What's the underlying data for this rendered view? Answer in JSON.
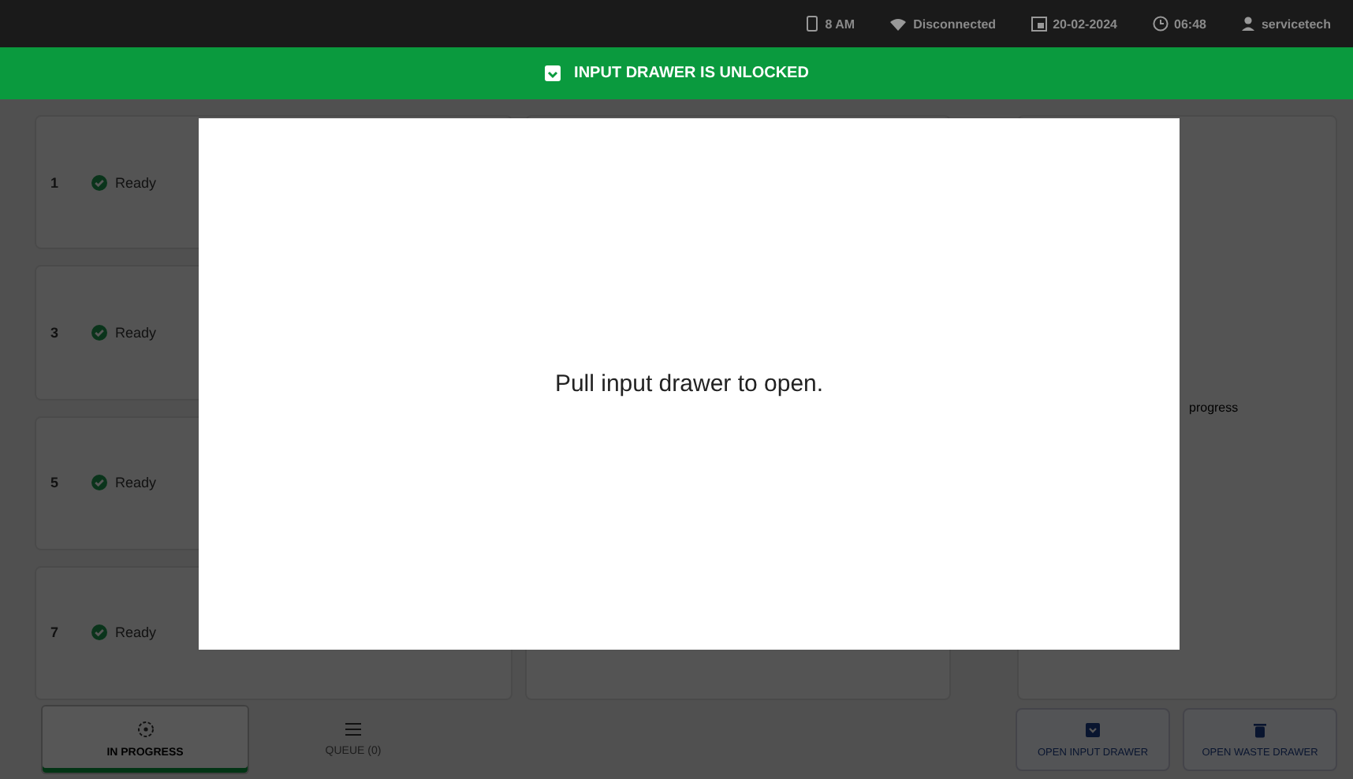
{
  "status_bar": {
    "battery": "8 AM",
    "network": "Disconnected",
    "date": "20-02-2024",
    "time": "06:48",
    "user": "servicetech"
  },
  "banner": {
    "text": "INPUT DRAWER IS UNLOCKED"
  },
  "slots": [
    {
      "number": "1",
      "status": "Ready"
    },
    {
      "number": "3",
      "status": "Ready"
    },
    {
      "number": "5",
      "status": "Ready"
    },
    {
      "number": "7",
      "status": "Ready"
    }
  ],
  "side_panel": {
    "text": "progress"
  },
  "tabs": [
    {
      "label": "IN PROGRESS",
      "selected": true
    },
    {
      "label": "QUEUE (0)",
      "selected": false
    }
  ],
  "buttons": [
    "OPEN INPUT DRAWER",
    "OPEN WASTE DRAWER"
  ],
  "dialog": {
    "message": "Pull input drawer to open."
  }
}
